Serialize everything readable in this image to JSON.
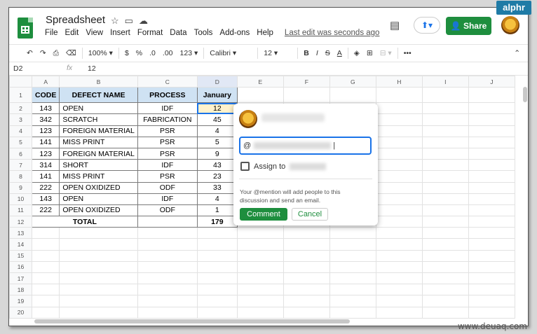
{
  "badge": "alphr",
  "watermark": "www.deuaq.com",
  "header": {
    "title": "Spreadsheet",
    "menu": [
      "File",
      "Edit",
      "View",
      "Insert",
      "Format",
      "Data",
      "Tools",
      "Add-ons",
      "Help"
    ],
    "last_edit": "Last edit was seconds ago",
    "share_label": "Share"
  },
  "toolbar": {
    "zoom": "100%",
    "currency": "$",
    "percent": "%",
    "dec_less": ".0",
    "dec_more": ".00",
    "format_more": "123",
    "font": "Calibri",
    "font_size": "12",
    "bold": "B",
    "italic": "I",
    "strike": "S",
    "text_color": "A"
  },
  "formula_bar": {
    "cell_ref": "D2",
    "fx": "fx",
    "value": "12"
  },
  "columns": [
    "A",
    "B",
    "C",
    "D",
    "E",
    "F",
    "G",
    "H",
    "I",
    "J"
  ],
  "table": {
    "headers": [
      "CODE",
      "DEFECT NAME",
      "PROCESS",
      "January"
    ],
    "rows": [
      [
        "143",
        "OPEN",
        "IDF",
        "12"
      ],
      [
        "342",
        "SCRATCH",
        "FABRICATION",
        "45"
      ],
      [
        "123",
        "FOREIGN MATERIAL",
        "PSR",
        "4"
      ],
      [
        "141",
        "MISS PRINT",
        "PSR",
        "5"
      ],
      [
        "123",
        "FOREIGN MATERIAL",
        "PSR",
        "9"
      ],
      [
        "314",
        "SHORT",
        "IDF",
        "43"
      ],
      [
        "141",
        "MISS PRINT",
        "PSR",
        "23"
      ],
      [
        "222",
        "OPEN OXIDIZED",
        "ODF",
        "33"
      ],
      [
        "143",
        "OPEN",
        "IDF",
        "4"
      ],
      [
        "222",
        "OPEN OXIDIZED",
        "ODF",
        "1"
      ]
    ],
    "total_label": "TOTAL",
    "total_value": "179"
  },
  "comment_popup": {
    "mention_prefix": "@",
    "assign_label": "Assign to",
    "note": "Your @mention will add people to this discussion and send an email.",
    "comment_button": "Comment",
    "cancel_button": "Cancel"
  }
}
